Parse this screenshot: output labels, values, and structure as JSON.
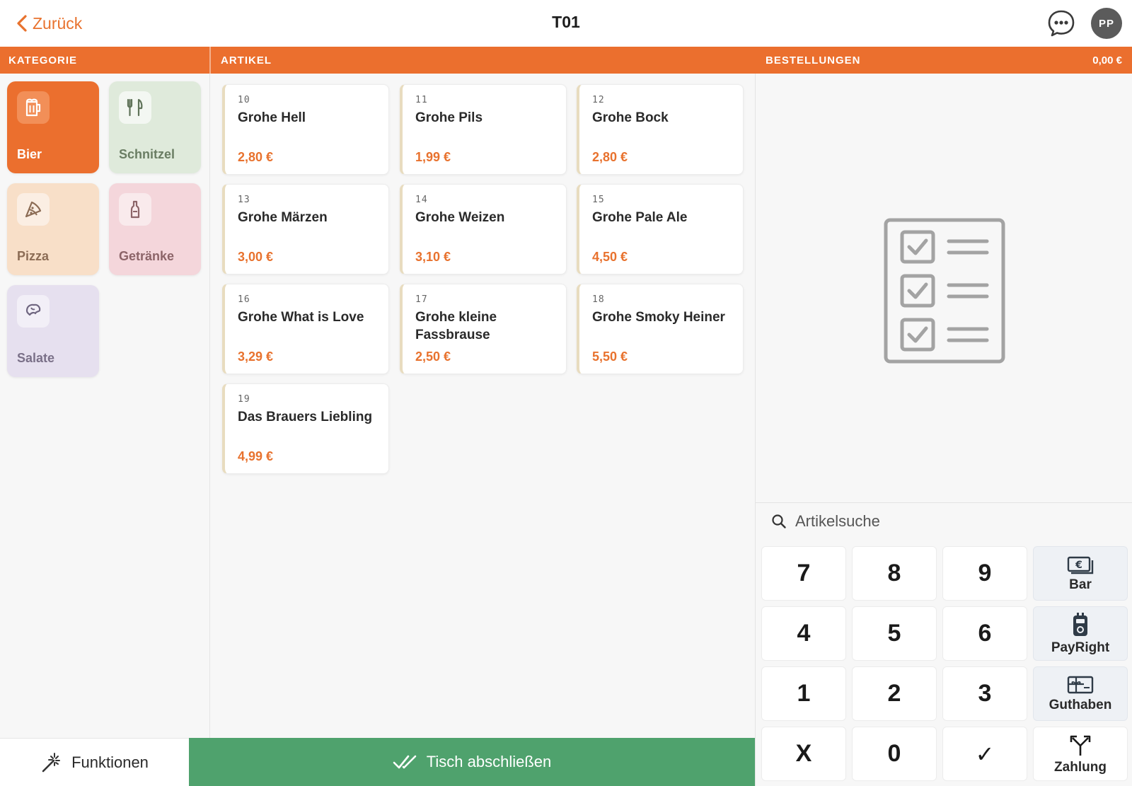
{
  "header": {
    "back_label": "Zurück",
    "table_title": "T01",
    "avatar_initials": "PP"
  },
  "bars": {
    "category": "KATEGORIE",
    "articles": "ARTIKEL",
    "orders": "BESTELLUNGEN",
    "orders_total": "0,00 €"
  },
  "categories": [
    {
      "label": "Bier",
      "icon": "beer-mug-icon",
      "bg": "#eb6f2e",
      "color": "#ffffff",
      "selected": true
    },
    {
      "label": "Schnitzel",
      "icon": "fork-knife-icon",
      "bg": "#dfeadb",
      "color": "#6a7d63"
    },
    {
      "label": "Pizza",
      "icon": "pizza-slice-icon",
      "bg": "#f8dfc8",
      "color": "#8c6c55"
    },
    {
      "label": "Getränke",
      "icon": "bottle-icon",
      "bg": "#f4d6db",
      "color": "#8c6468"
    },
    {
      "label": "Salate",
      "icon": "salad-icon",
      "bg": "#e6e0ef",
      "color": "#7a7088"
    }
  ],
  "articles": [
    {
      "number": "10",
      "name": "Grohe Hell",
      "price": "2,80 €"
    },
    {
      "number": "11",
      "name": "Grohe Pils",
      "price": "1,99 €"
    },
    {
      "number": "12",
      "name": "Grohe Bock",
      "price": "2,80 €"
    },
    {
      "number": "13",
      "name": "Grohe Märzen",
      "price": "3,00 €"
    },
    {
      "number": "14",
      "name": "Grohe Weizen",
      "price": "3,10 €"
    },
    {
      "number": "15",
      "name": "Grohe Pale Ale",
      "price": "4,50 €"
    },
    {
      "number": "16",
      "name": "Grohe What is Love",
      "price": "3,29 €"
    },
    {
      "number": "17",
      "name": "Grohe kleine Fassbrause",
      "price": "2,50 €"
    },
    {
      "number": "18",
      "name": "Grohe Smoky Heiner",
      "price": "5,50 €"
    },
    {
      "number": "19",
      "name": "Das Brauers Liebling",
      "price": "4,99 €"
    }
  ],
  "orders": {
    "empty_icon": "checklist-icon"
  },
  "search": {
    "placeholder": "Artikelsuche"
  },
  "keypad": {
    "keys": [
      "7",
      "8",
      "9",
      "4",
      "5",
      "6",
      "1",
      "2",
      "3",
      "X",
      "0",
      "✓"
    ]
  },
  "payments": [
    {
      "label": "Bar",
      "icon": "cash-euro-icon"
    },
    {
      "label": "PayRight",
      "icon": "payright-terminal-icon"
    },
    {
      "label": "Guthaben",
      "icon": "gift-card-icon"
    },
    {
      "label": "Zahlung",
      "icon": "split-arrows-icon"
    }
  ],
  "footer": {
    "functions_label": "Funktionen",
    "close_table_label": "Tisch abschließen"
  }
}
